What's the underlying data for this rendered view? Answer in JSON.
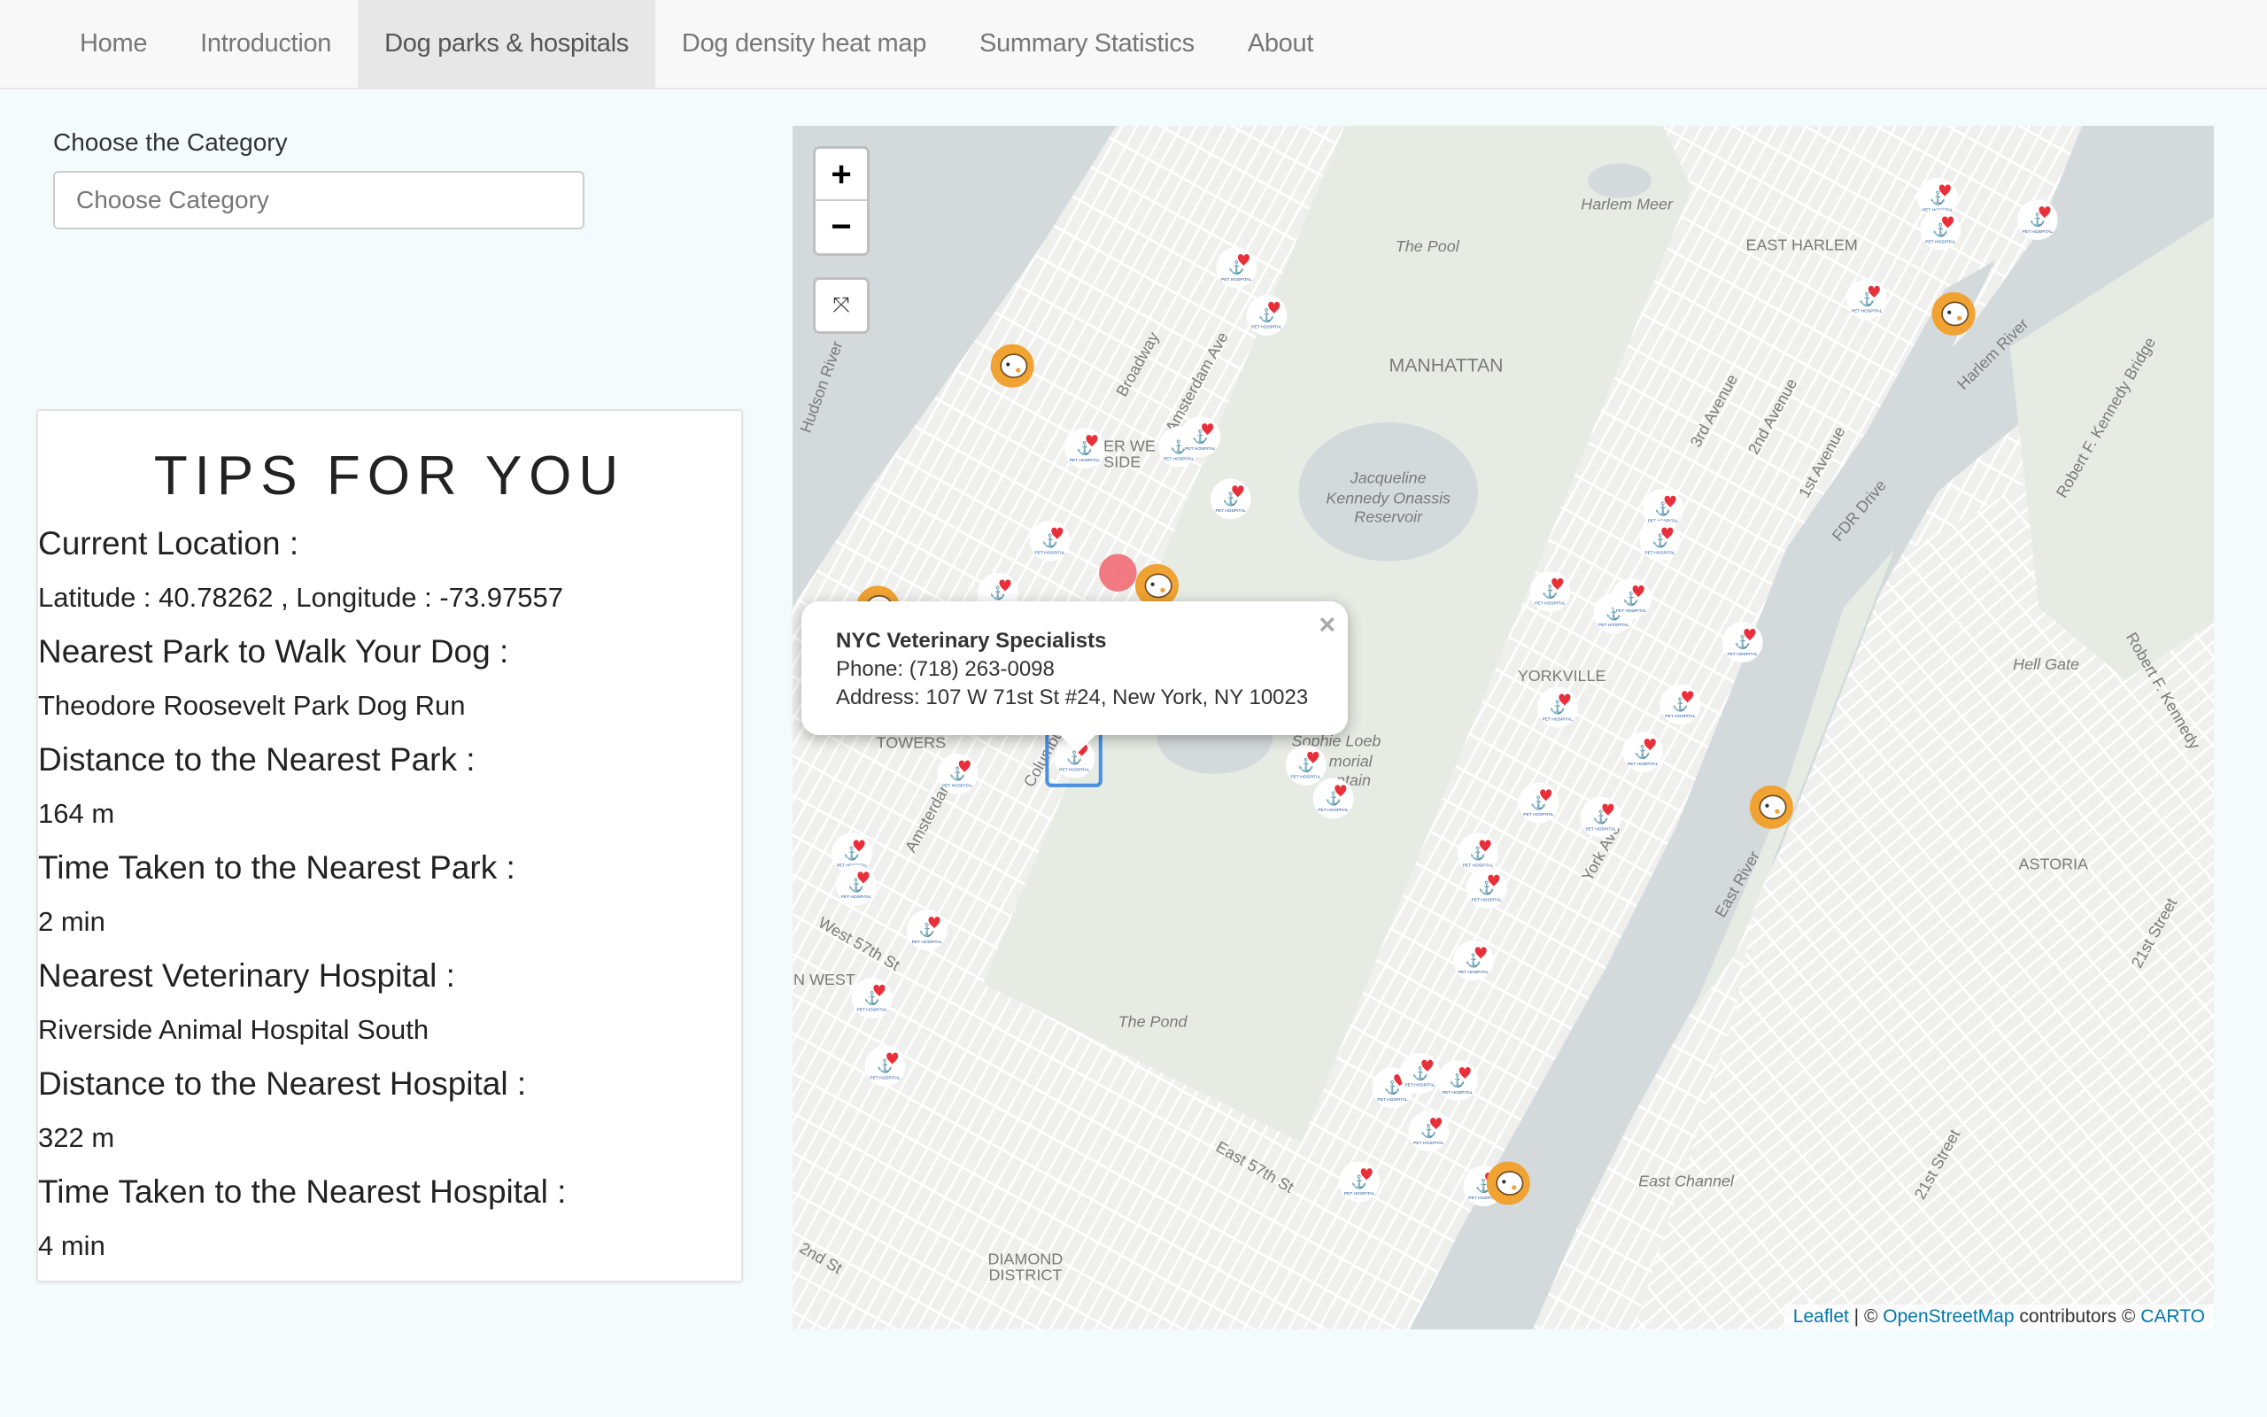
{
  "nav": {
    "items": [
      "Home",
      "Introduction",
      "Dog parks & hospitals",
      "Dog density heat map",
      "Summary Statistics",
      "About"
    ],
    "active": "Dog parks & hospitals"
  },
  "filter": {
    "label": "Choose the Category",
    "placeholder": "Choose Category"
  },
  "tips": {
    "title": "TIPS FOR YOU",
    "current_location_label": "Current Location :",
    "current_location_value": "Latitude : 40.78262 , Longitude : -73.97557",
    "nearest_park_label": "Nearest Park to Walk Your Dog :",
    "nearest_park_value": "Theodore Roosevelt Park Dog Run",
    "park_distance_label": "Distance to the Nearest Park :",
    "park_distance_value": "164 m",
    "park_time_label": "Time Taken to the Nearest Park :",
    "park_time_value": "2 min",
    "nearest_hospital_label": "Nearest Veterinary Hospital :",
    "nearest_hospital_value": "Riverside Animal Hospital South",
    "hospital_distance_label": "Distance to the Nearest Hospital :",
    "hospital_distance_value": "322 m",
    "hospital_time_label": "Time Taken to the Nearest Hospital :",
    "hospital_time_value": "4 min"
  },
  "map": {
    "zoom_in": "+",
    "zoom_out": "−",
    "fullscreen_icon": "collapse-icon",
    "popup": {
      "title": "NYC Veterinary Specialists",
      "phone": "Phone: (718) 263-0098",
      "address": "Address: 107 W 71st St #24, New York, NY 10023",
      "close": "×"
    },
    "attribution": {
      "leaflet": "Leaflet",
      "sep": " | © ",
      "osm": "OpenStreetMap",
      "contrib": " contributors © ",
      "carto": "CARTO"
    },
    "labels": [
      "Harlem Meer",
      "The Pool",
      "EAST HARLEM",
      "MANHATTAN",
      "Jacqueline",
      "Kennedy Onassis",
      "Reservoir",
      "YORKVILLE",
      "Hell Gate",
      "ASTORIA",
      "The Pond",
      "East Channel",
      "DIAMOND",
      "DISTRICT",
      "TOWERS",
      "ER WE",
      "SIDE",
      "Sophie Loeb",
      "morial",
      "ntain",
      "N WEST"
    ],
    "street_labels": [
      "Broadway",
      "Amsterdam Ave",
      "Columbus Avenue",
      "3rd Avenue",
      "2nd Avenue",
      "1st Avenue",
      "FDR Drive",
      "Harlem River",
      "Robert F. Kennedy Bridge",
      "21st Street",
      "East River",
      "West 57th St",
      "East 57th St",
      "Hudson River",
      "Amsterdam",
      "Robert F. Kennedy",
      "York Ave",
      "2nd St",
      "21st Street"
    ],
    "marker_hospital_text": "PET HOSPITAL",
    "colors": {
      "park_marker": "#f0a232",
      "hospital_heart": "#e8303a",
      "hospital_anchor": "#1d4f9c",
      "current_location": "#f06b75",
      "water": "#d4dadc",
      "park": "#e6ece4"
    }
  }
}
